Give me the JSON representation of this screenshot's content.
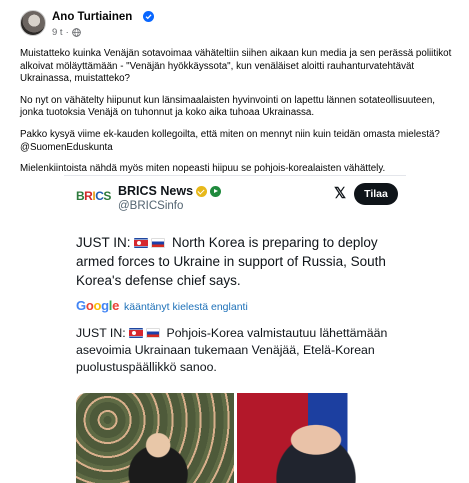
{
  "post": {
    "author": "Ano Turtiainen",
    "time": "9 t",
    "paragraphs": [
      "Muistatteko kuinka Venäjän sotavoimaa vähäteltiin siihen aikaan kun media ja sen perässä poliitikot alkoivat möläyttämään - \"Venäjän hyökkäyssota\", kun venäläiset aloitti rauhanturvatehtävät Ukrainassa, muistatteko?",
      "No nyt on vähätelty hiipunut kun länsimaalaisten hyvinvointi on lapettu lännen sotateollisuuteen, jonka tuotoksia Venäjä on tuhonnut ja koko aika tuhoaa Ukrainassa.",
      "Pakko kysyä viime ek-kauden kollegoilta, että miten on mennyt niin kuin teidän omasta mielestä? @SuomenEduskunta",
      "Mielenkiintoista nähdä myös miten nopeasti hiipuu se pohjois-korealaisten vähättely."
    ]
  },
  "embed": {
    "logo_letters": [
      "B",
      "R",
      "I",
      "C",
      "S"
    ],
    "account_name": "BRICS News",
    "handle": "@BRICSinfo",
    "x_logo": "𝕏",
    "follow_label": "Tilaa",
    "tweet_prefix": "JUST IN:",
    "tweet_body": "North Korea is preparing to deploy armed forces to Ukraine in support of Russia, South Korea's defense chief says.",
    "google_letters": [
      "G",
      "o",
      "o",
      "g",
      "l",
      "e"
    ],
    "translate_label": "kääntänyt kielestä englanti",
    "translated_prefix": "JUST IN:",
    "translated_body": "Pohjois-Korea valmistautuu lähettämään asevoimia Ukrainaan tukemaan Venäjää, Etelä-Korean puolustuspäällikkö sanoo."
  },
  "colors": {
    "verified_blue": "#0866ff",
    "link_blue": "#1d70b8",
    "muted_gray": "#65676b"
  },
  "icons": [
    "verified-badge-icon",
    "globe-icon",
    "gold-verified-icon",
    "play-badge-icon",
    "x-logo-icon"
  ]
}
